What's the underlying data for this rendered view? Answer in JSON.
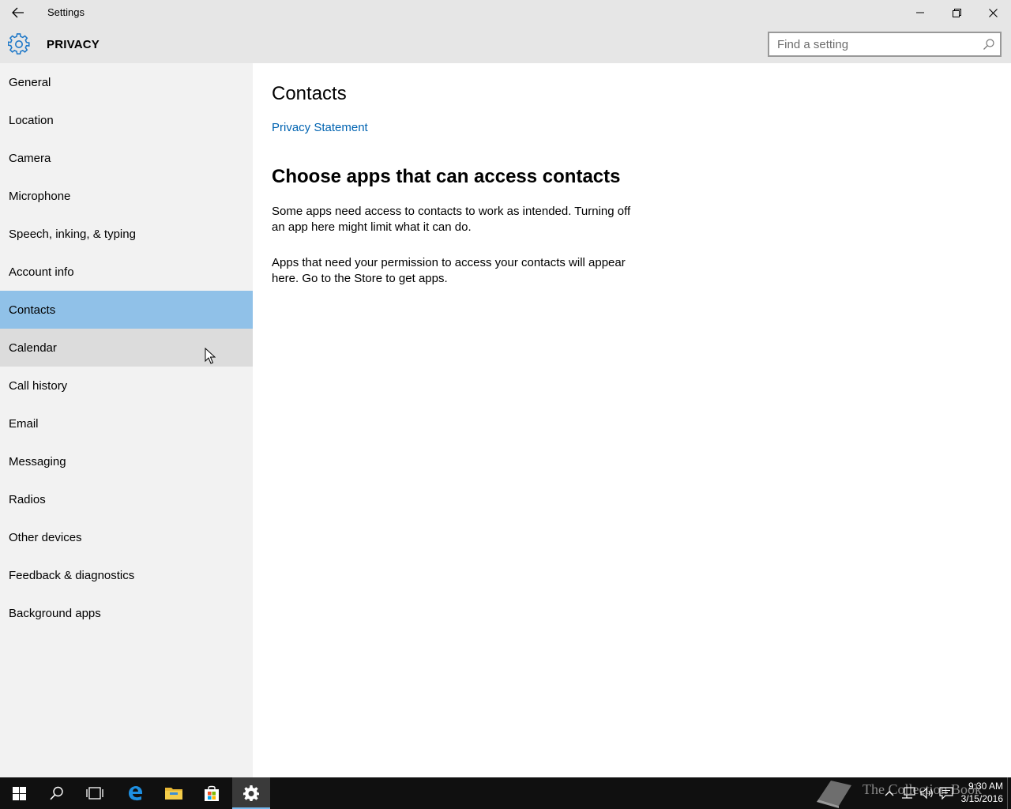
{
  "window": {
    "title": "Settings"
  },
  "header": {
    "title": "PRIVACY",
    "search_placeholder": "Find a setting"
  },
  "sidebar": {
    "items": [
      {
        "label": "General"
      },
      {
        "label": "Location"
      },
      {
        "label": "Camera"
      },
      {
        "label": "Microphone"
      },
      {
        "label": "Speech, inking, & typing"
      },
      {
        "label": "Account info"
      },
      {
        "label": "Contacts",
        "selected": true
      },
      {
        "label": "Calendar",
        "hover": true
      },
      {
        "label": "Call history"
      },
      {
        "label": "Email"
      },
      {
        "label": "Messaging"
      },
      {
        "label": "Radios"
      },
      {
        "label": "Other devices"
      },
      {
        "label": "Feedback & diagnostics"
      },
      {
        "label": "Background apps"
      }
    ]
  },
  "content": {
    "title": "Contacts",
    "privacy_link": "Privacy Statement",
    "section_title": "Choose apps that can access contacts",
    "para1": "Some apps need access to contacts to work as intended. Turning off an app here might limit what it can do.",
    "para2": "Apps that need your permission to access your contacts will appear here. Go to the Store to get apps."
  },
  "taskbar": {
    "watermark": "The Collection Book",
    "time": "9:30 AM",
    "date": "3/15/2016",
    "apps": [
      "start-icon",
      "search-icon",
      "task-view-icon",
      "edge-icon",
      "file-explorer-icon",
      "store-icon",
      "settings-icon"
    ]
  },
  "colors": {
    "accent": "#0063b1",
    "selected_bg": "#90c1e8",
    "sidebar_bg": "#f2f2f2",
    "titlebar_bg": "#e6e6e6",
    "taskbar_bg": "#101010"
  }
}
